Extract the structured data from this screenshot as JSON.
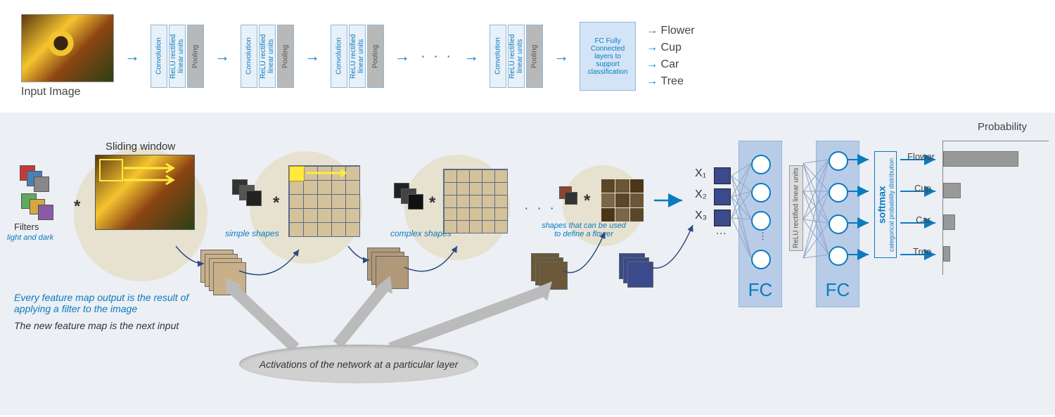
{
  "top": {
    "input_label": "Input Image",
    "blocks": [
      [
        "Convolution",
        "ReLU\nrectified linear units",
        "Pooling"
      ],
      [
        "Convolution",
        "ReLU\nrectified linear units",
        "Pooling"
      ],
      [
        "Convolution",
        "ReLU\nrectified linear units",
        "Pooling"
      ],
      [
        "Convolution",
        "ReLU\nrectified linear units",
        "Pooling"
      ]
    ],
    "dots": "· · ·",
    "fc": "FC\nFully Connected layers to support classification",
    "outputs": [
      "Flower",
      "Cup",
      "Car",
      "Tree"
    ]
  },
  "bottom": {
    "sliding_window": "Sliding window",
    "filters": "Filters",
    "filters_sub": "light and dark",
    "caption1": "Every feature map output is the result of applying a filter to the image",
    "caption2": "The new feature map is the next input",
    "shape_labels": [
      "simple shapes",
      "complex shapes",
      "shapes that can be used to define a flower"
    ],
    "activations": "Activations of the network at a particular layer",
    "x_labels": [
      "X₁",
      "X₂",
      "X₃"
    ],
    "fc_label": "FC",
    "relu": "ReLU\nrectified linear units",
    "softmax_bold": "softmax",
    "softmax_sub": "categorical probability distribution",
    "prob_title": "Probability",
    "classes": [
      "Flower",
      "Cup",
      "Car",
      "Tree"
    ]
  },
  "chart_data": {
    "type": "bar",
    "categories": [
      "Flower",
      "Cup",
      "Car",
      "Tree"
    ],
    "values": [
      0.7,
      0.15,
      0.1,
      0.05
    ],
    "title": "Probability",
    "xlabel": "",
    "ylabel": "",
    "ylim": [
      0,
      1
    ]
  }
}
